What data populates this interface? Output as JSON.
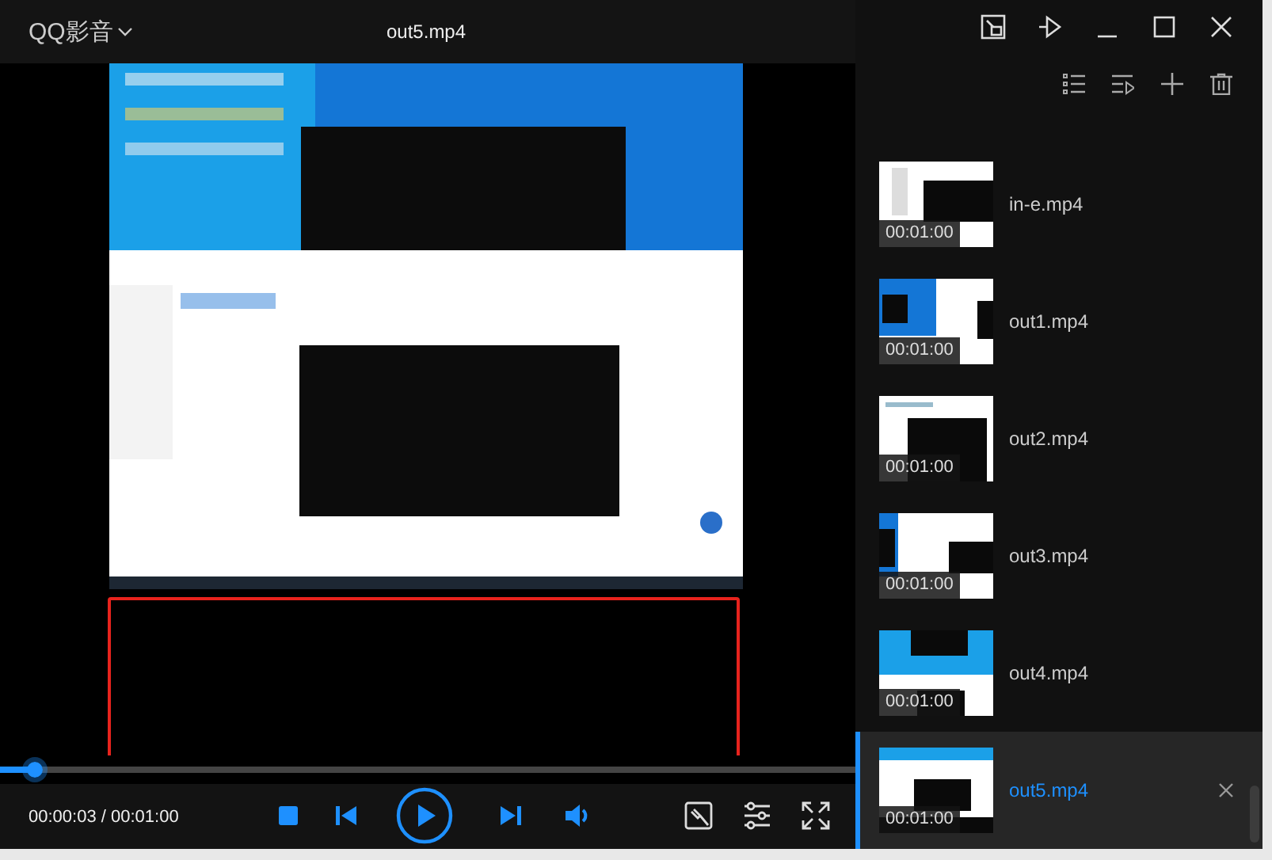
{
  "window": {
    "app_name": "QQ影音",
    "title": "out5.mp4"
  },
  "player": {
    "time": "00:00:03 / 00:01:00",
    "level": 0.04,
    "annotation": {
      "kind": "rectangle"
    }
  },
  "playlist": [
    {
      "name": "in-e.mp4",
      "duration": "00:01:00",
      "selected": false
    },
    {
      "name": "out1.mp4",
      "duration": "00:01:00",
      "selected": false
    },
    {
      "name": "out2.mp4",
      "duration": "00:01:00",
      "selected": false
    },
    {
      "name": "out3.mp4",
      "duration": "00:01:00",
      "selected": false
    },
    {
      "name": "out4.mp4",
      "duration": "00:01:00",
      "selected": false
    },
    {
      "name": "out5.mp4",
      "duration": "00:01:00",
      "selected": true
    }
  ]
}
